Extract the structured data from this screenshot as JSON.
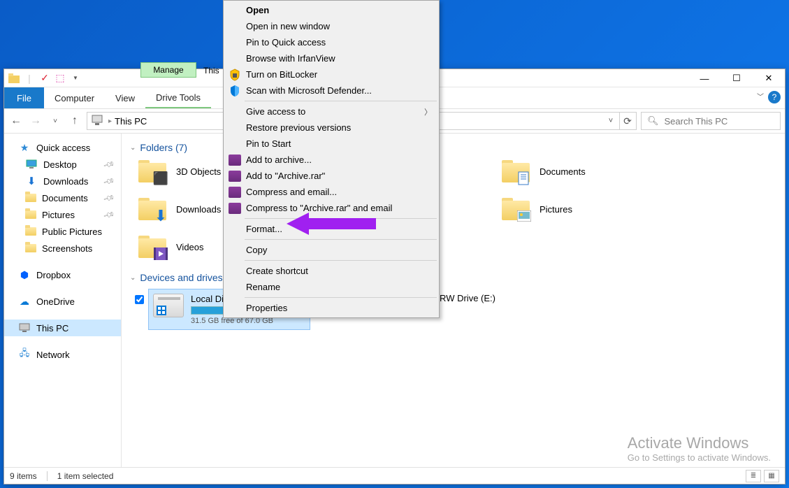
{
  "ribbon": {
    "manage": "Manage",
    "ctx_title": "This",
    "file": "File",
    "tabs": [
      "Computer",
      "View"
    ],
    "ctx_tab": "Drive Tools"
  },
  "window_controls": {
    "min": "—",
    "max": "☐",
    "close": "✕"
  },
  "nav": {
    "location": "This PC",
    "search_placeholder": "Search This PC"
  },
  "sidebar": {
    "quick_access": "Quick access",
    "pinned": [
      {
        "label": "Desktop",
        "icon": "desktop"
      },
      {
        "label": "Downloads",
        "icon": "downloads"
      },
      {
        "label": "Documents",
        "icon": "documents"
      },
      {
        "label": "Pictures",
        "icon": "pictures"
      }
    ],
    "recent": [
      "Public Pictures",
      "Screenshots"
    ],
    "dropbox": "Dropbox",
    "onedrive": "OneDrive",
    "this_pc": "This PC",
    "network": "Network"
  },
  "content": {
    "folders_header": "Folders (7)",
    "folders": [
      {
        "label": "3D Objects",
        "badge": "cube"
      },
      {
        "label": "Documents",
        "badge": "doc",
        "col": 3
      },
      {
        "label": "Downloads",
        "badge": "down"
      },
      {
        "label": "Pictures",
        "badge": "pic",
        "col": 3
      },
      {
        "label": "Videos",
        "badge": "vid"
      }
    ],
    "drives_header": "Devices and drives (",
    "local_disk": {
      "name": "Local Disk (",
      "free_text": "31.5 GB free of 67.0 GB"
    },
    "dvd_label_cut": "DVD RW Drive (E:)",
    "dvd_badge": "DVD"
  },
  "status": {
    "items": "9 items",
    "selected": "1 item selected"
  },
  "watermark": {
    "title": "Activate Windows",
    "sub": "Go to Settings to activate Windows."
  },
  "ctx": {
    "open": "Open",
    "open_new": "Open in new window",
    "pin_qa": "Pin to Quick access",
    "browse_irf": "Browse with IrfanView",
    "bitlocker": "Turn on BitLocker",
    "defender": "Scan with Microsoft Defender...",
    "give_access": "Give access to",
    "restore": "Restore previous versions",
    "pin_start": "Pin to Start",
    "add_archive": "Add to archive...",
    "add_archive_rar": "Add to \"Archive.rar\"",
    "compress_email": "Compress and email...",
    "compress_rar_email": "Compress to \"Archive.rar\" and email",
    "format": "Format...",
    "copy": "Copy",
    "shortcut": "Create shortcut",
    "rename": "Rename",
    "properties": "Properties"
  }
}
